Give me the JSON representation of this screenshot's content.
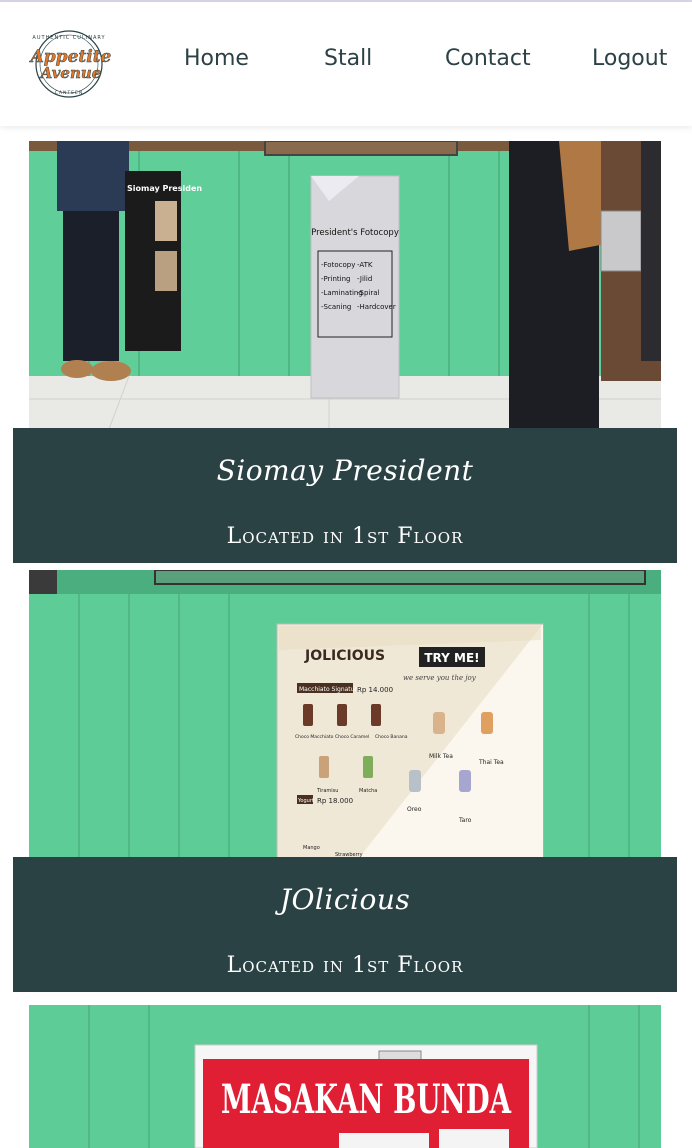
{
  "brand": {
    "logo_top_text": "AUTHENTIC CULINARY",
    "logo_line1": "Appetite",
    "logo_line2": "Avenue",
    "logo_bottom_text": "CANTEEN",
    "accent_color": "#e0782c",
    "dark_color": "#2b4245"
  },
  "nav": {
    "items": [
      {
        "label": "Home"
      },
      {
        "label": "Stall"
      },
      {
        "label": "Contact"
      },
      {
        "label": "Logout"
      }
    ]
  },
  "stalls": [
    {
      "name": "Siomay President",
      "location": "Located in 1st Floor",
      "photo": {
        "poster_left_title": "Siomay Presiden",
        "poster_title": "President's Fotocopy",
        "services_left": [
          "-Fotocopy",
          "-Printing",
          "-Laminating",
          "-Scaning"
        ],
        "services_right": [
          "-ATK",
          "-Jilid",
          "-Spiral",
          "-Hardcover"
        ]
      }
    },
    {
      "name": "JOlicious",
      "location": "Located in 1st Floor",
      "photo": {
        "menu_brand": "JOLICIOUS",
        "menu_badge": "TRY ME!",
        "menu_tagline": "we serve you the joy",
        "signature_label": "Macchiato Signature",
        "signature_price": "Rp 14.000",
        "yogurt_label": "Yogurt",
        "yogurt_price": "Rp 18.000",
        "items_left": [
          "Choco Macchiato",
          "Choco Caramel",
          "Choco Banana",
          "Tiramisu",
          "Matcha",
          "Mango",
          "Strawberry"
        ],
        "items_right": [
          "Milk Tea",
          "Thai Tea",
          "Oreo",
          "Taro"
        ]
      }
    },
    {
      "name": "Masakan Bunda",
      "location": "",
      "photo": {
        "banner_text": "MASAKAN BUNDA"
      }
    }
  ]
}
